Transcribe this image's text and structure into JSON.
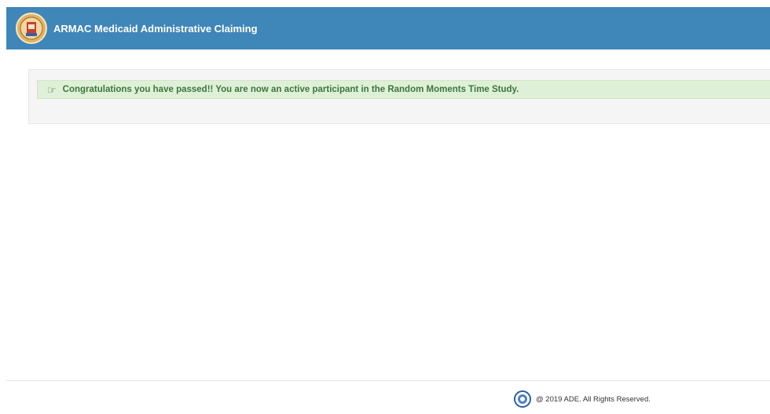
{
  "header": {
    "app_title": "ARMAC Medicaid Administrative Claiming",
    "logo_icon": "state-seal-icon",
    "background_color": "#3f86b9"
  },
  "alert": {
    "icon": "hand-pointing-right-icon",
    "message": "Congratulations you have passed!! You are now an active participant in the Random Moments Time Study.",
    "background_color": "#dff0d8",
    "text_color": "#3c763d"
  },
  "footer": {
    "icon": "seal-icon",
    "copyright": "@ 2019 ADE. All Rights Reserved."
  }
}
